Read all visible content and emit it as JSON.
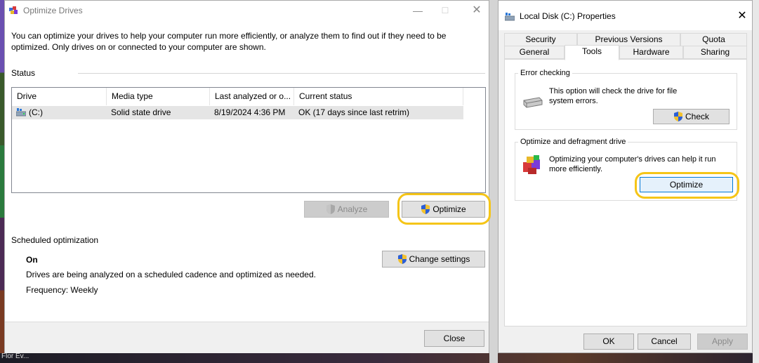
{
  "optimize_window": {
    "title": "Optimize Drives",
    "intro": "You can optimize your drives to help your computer run more efficiently, or analyze them to find out if they need to be optimized. Only drives on or connected to your computer are shown.",
    "status_label": "Status",
    "columns": [
      "Drive",
      "Media type",
      "Last analyzed or o...",
      "Current status"
    ],
    "drives": [
      {
        "drive": "(C:)",
        "media_type": "Solid state drive",
        "last_analyzed": "8/19/2024 4:36 PM",
        "current_status": "OK (17 days since last retrim)"
      }
    ],
    "analyze_label": "Analyze",
    "optimize_label": "Optimize",
    "scheduled_label": "Scheduled optimization",
    "schedule_state": "On",
    "schedule_desc": "Drives are being analyzed on a scheduled cadence and optimized as needed.",
    "frequency": "Frequency: Weekly",
    "change_settings_label": "Change settings",
    "close_label": "Close"
  },
  "properties_window": {
    "title": "Local Disk (C:) Properties",
    "tabs_row1": [
      "Security",
      "Previous Versions",
      "Quota"
    ],
    "tabs_row2": [
      "General",
      "Tools",
      "Hardware",
      "Sharing"
    ],
    "active_tab": "Tools",
    "error_checking": {
      "label": "Error checking",
      "text": "This option will check the drive for file system errors.",
      "button": "Check"
    },
    "optimize_group": {
      "label": "Optimize and defragment drive",
      "text": "Optimizing your computer's drives can help it run more efficiently.",
      "button": "Optimize"
    },
    "ok_label": "OK",
    "cancel_label": "Cancel",
    "apply_label": "Apply"
  },
  "desktop": {
    "taskbar_text": "Flor Ev..."
  },
  "colors": {
    "highlight": "#f5c518",
    "selected_row": "#e5e5e5",
    "dialog_bg": "#f0f0f0"
  }
}
